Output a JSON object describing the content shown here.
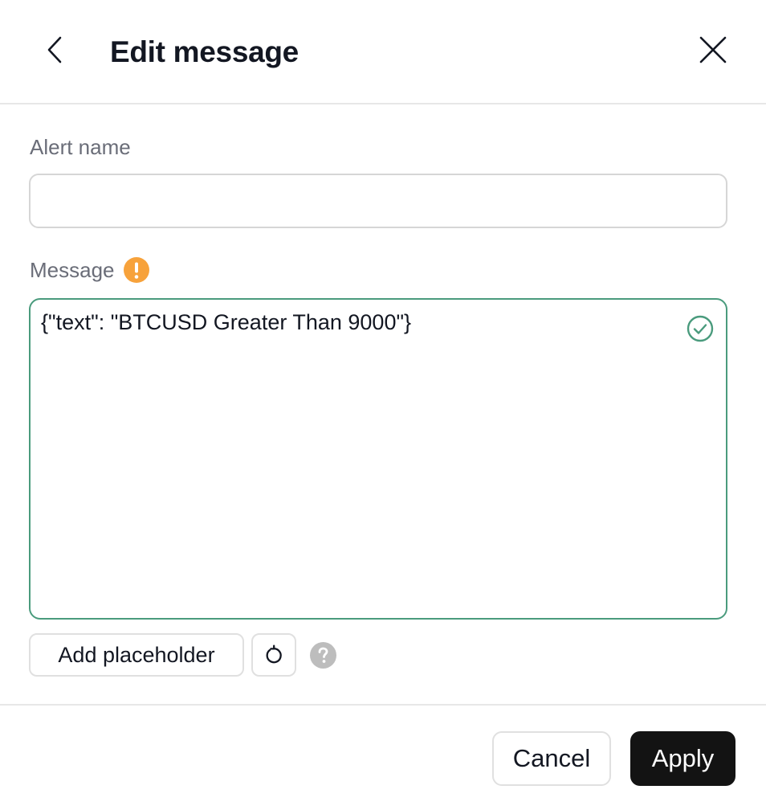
{
  "header": {
    "title": "Edit message",
    "back_icon": "chevron-left-icon",
    "close_icon": "close-icon"
  },
  "form": {
    "alert_name": {
      "label": "Alert name",
      "value": "",
      "placeholder": ""
    },
    "message": {
      "label": "Message",
      "warning_icon": "warning-icon",
      "value": "{\"text\": \"BTCUSD Greater Than 9000\"}",
      "valid_icon": "check-circle-icon"
    }
  },
  "actions": {
    "add_placeholder_label": "Add placeholder",
    "reset_icon": "reset-icon",
    "help_icon": "help-icon"
  },
  "footer": {
    "cancel_label": "Cancel",
    "apply_label": "Apply"
  },
  "colors": {
    "accent_valid": "#4a9b7d",
    "warning": "#f7a23b",
    "primary_button": "#131313",
    "label_text": "#6a6d78"
  }
}
